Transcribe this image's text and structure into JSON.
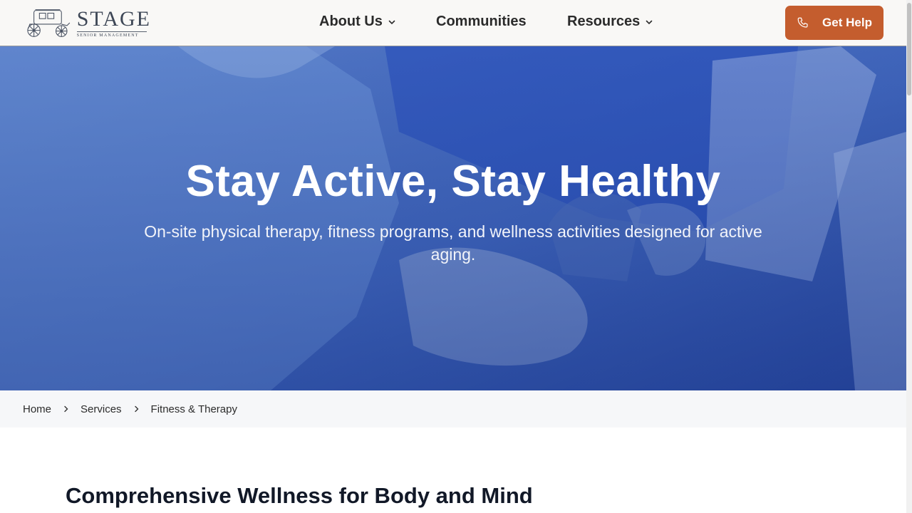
{
  "header": {
    "logo": {
      "word": "STAGE",
      "sub": "SENIOR MANAGEMENT"
    },
    "nav": [
      {
        "label": "About Us",
        "has_dropdown": true
      },
      {
        "label": "Communities",
        "has_dropdown": false
      },
      {
        "label": "Resources",
        "has_dropdown": true
      }
    ],
    "cta": {
      "label": "Get Help",
      "icon": "phone-icon"
    }
  },
  "hero": {
    "title": "Stay Active, Stay Healthy",
    "subtitle": "On-site physical therapy, fitness programs, and wellness activities designed for active aging."
  },
  "breadcrumb": [
    {
      "label": "Home"
    },
    {
      "label": "Services"
    },
    {
      "label": "Fitness & Therapy"
    }
  ],
  "main": {
    "section_title": "Comprehensive Wellness for Body and Mind"
  },
  "colors": {
    "accent": "#c45d2e",
    "hero_overlay": "#3f64b8",
    "header_bg": "#f9f8f6",
    "breadcrumb_bg": "#f6f7f9"
  }
}
